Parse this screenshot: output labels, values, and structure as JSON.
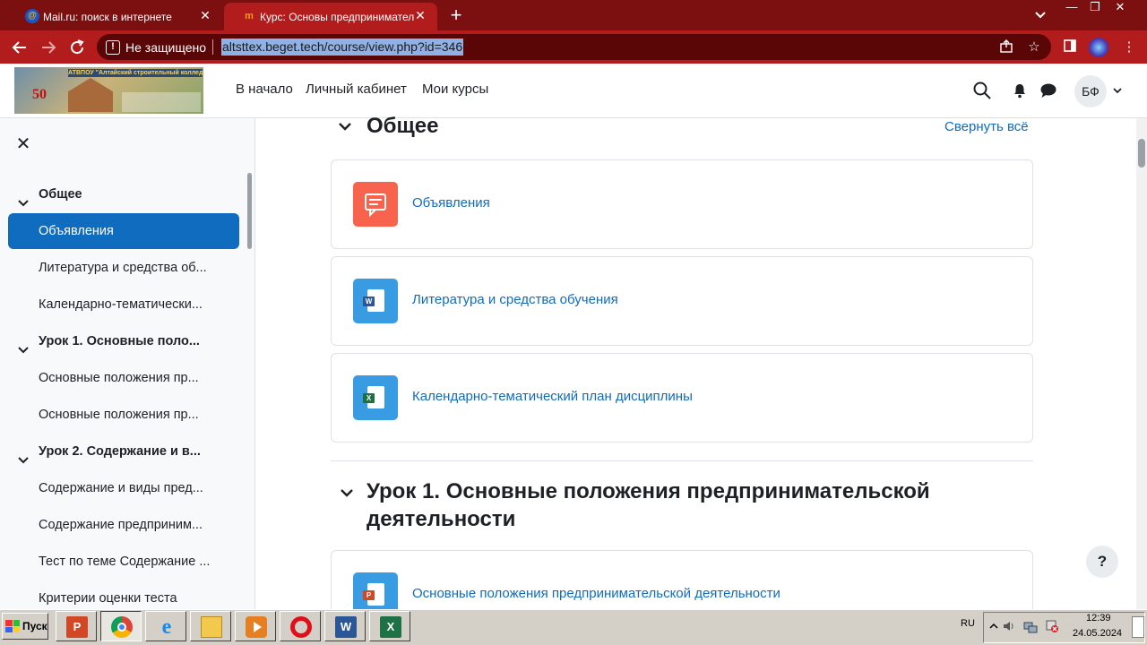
{
  "browser": {
    "tabs": [
      {
        "title": "Mail.ru: поиск в интернете",
        "active": false
      },
      {
        "title": "Курс: Основы предпринимательской деятельности",
        "active": true
      }
    ],
    "security_label": "Не защищено",
    "url": "altsttex.beget.tech/course/view.php?id=346",
    "accent": "#b31c1c"
  },
  "header": {
    "logo_text": "АТВПОУ \"Алтайский строительный колледж\"",
    "logo_number": "50",
    "nav": [
      "В начало",
      "Личный кабинет",
      "Мои курсы"
    ],
    "avatar_initials": "БФ"
  },
  "course_index": {
    "items": [
      {
        "label": "Общее",
        "type": "section"
      },
      {
        "label": "Объявления",
        "type": "activity",
        "active": true
      },
      {
        "label": "Литература и средства об...",
        "type": "activity"
      },
      {
        "label": "Календарно-тематически...",
        "type": "activity"
      },
      {
        "label": "Урок 1. Основные поло...",
        "type": "section"
      },
      {
        "label": "Основные положения пр...",
        "type": "activity"
      },
      {
        "label": "Основные положения пр...",
        "type": "activity"
      },
      {
        "label": "Урок 2. Содержание и в...",
        "type": "section"
      },
      {
        "label": "Содержание и виды пред...",
        "type": "activity"
      },
      {
        "label": "Содержание предприним...",
        "type": "activity"
      },
      {
        "label": "Тест по теме Содержание ...",
        "type": "activity"
      },
      {
        "label": "Критерии оценки теста",
        "type": "activity"
      }
    ]
  },
  "main": {
    "collapse_all": "Свернуть всё",
    "sections": [
      {
        "title": "Общее"
      },
      {
        "title": "Урок 1. Основные положения предпринимательской",
        "title_line2": "деятельности"
      }
    ],
    "activities": [
      {
        "title": "Объявления",
        "icon": "forum-icon",
        "color": "#f7634d"
      },
      {
        "title": "Литература и средства обучения",
        "icon": "word-document-icon",
        "color": "#399be2"
      },
      {
        "title": "Календарно-тематический план дисциплины",
        "icon": "excel-document-icon",
        "color": "#399be2"
      },
      {
        "title": "Основные положения предпринимательской деятельности",
        "icon": "powerpoint-document-icon",
        "color": "#399be2"
      }
    ],
    "help": "?"
  },
  "taskbar": {
    "start": "Пуск",
    "apps": [
      "powerpoint-icon",
      "chrome-icon",
      "internet-explorer-icon",
      "file-explorer-icon",
      "media-player-icon",
      "opera-icon",
      "word-icon",
      "excel-icon"
    ],
    "lang": "RU",
    "time": "12:39",
    "date": "24.05.2024"
  }
}
